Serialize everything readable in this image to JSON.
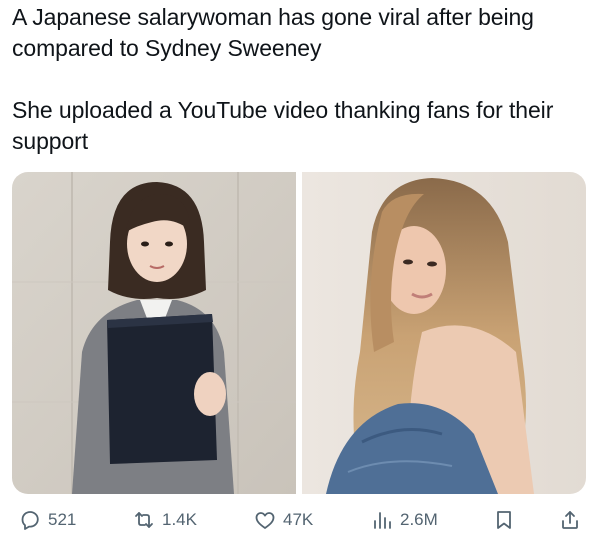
{
  "tweet": {
    "text_line1": "A Japanese salarywoman has gone viral after being compared to Sydney Sweeney",
    "text_line2": "She uploaded a YouTube video thanking fans for their support"
  },
  "media": {
    "photos": [
      {
        "subject": "woman in grey suit holding black folder"
      },
      {
        "subject": "woman with long blonde hair in denim jacket"
      }
    ]
  },
  "actions": {
    "replies": "521",
    "reposts": "1.4K",
    "likes": "47K",
    "views": "2.6M"
  },
  "icons": {
    "reply": "reply-icon",
    "repost": "repost-icon",
    "like": "heart-icon",
    "views": "views-icon",
    "bookmark": "bookmark-icon",
    "share": "share-icon"
  },
  "colors": {
    "text": "#0f1419",
    "muted": "#536471"
  }
}
